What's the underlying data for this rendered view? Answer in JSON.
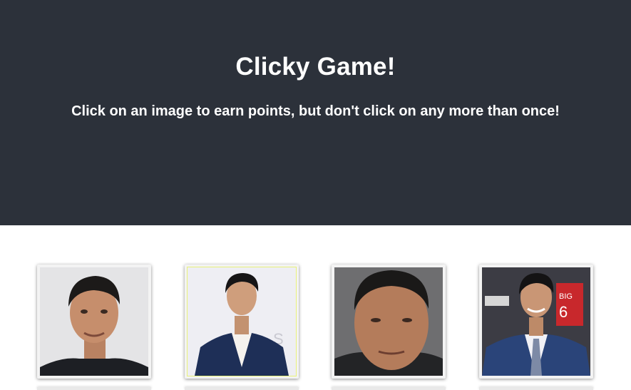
{
  "header": {
    "title": "Clicky Game!",
    "instructions": "Click on an image to earn points, but don't click on any more than once!"
  },
  "cards": [
    {
      "icon": "portrait-man-dark-shirt"
    },
    {
      "icon": "portrait-man-navy-suit"
    },
    {
      "icon": "portrait-man-closeup"
    },
    {
      "icon": "portrait-man-suit-poster-background"
    }
  ],
  "colors": {
    "header_bg": "#2c313a",
    "header_text": "#ffffff",
    "page_bg": "#ffffff"
  }
}
